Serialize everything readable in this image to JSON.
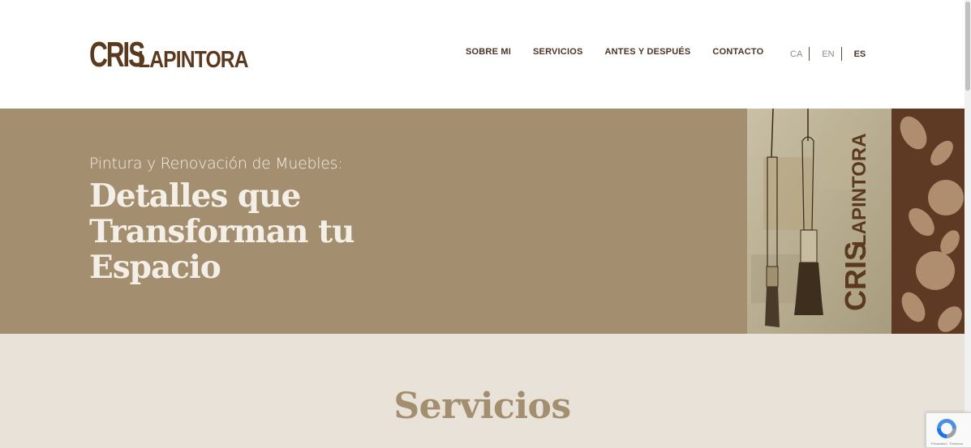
{
  "brand": {
    "logo_part1": "CRIS",
    "logo_part2": "LAPINTORA",
    "color_primary": "#5a3a1e",
    "color_hero": "#a38e70",
    "color_section_bg": "#e8e2d8"
  },
  "nav": {
    "items": [
      {
        "label": "SOBRE MI"
      },
      {
        "label": "SERVICIOS"
      },
      {
        "label": "ANTES Y DESPUÉS"
      },
      {
        "label": "CONTACTO"
      }
    ]
  },
  "languages": {
    "items": [
      {
        "label": "CA",
        "active": false
      },
      {
        "label": "EN",
        "active": false
      },
      {
        "label": "ES",
        "active": true
      }
    ]
  },
  "hero": {
    "subtitle": "Pintura y Renovación de Muebles:",
    "title": "Detalles que Transforman tu Espacio",
    "image": {
      "description_icon": "paintbrush-icon",
      "logo_line1": "CRIS",
      "logo_line2": "LAPINTORA"
    }
  },
  "services": {
    "title": "Servicios"
  },
  "recaptcha": {
    "footer": "Privacidad - Términos"
  }
}
